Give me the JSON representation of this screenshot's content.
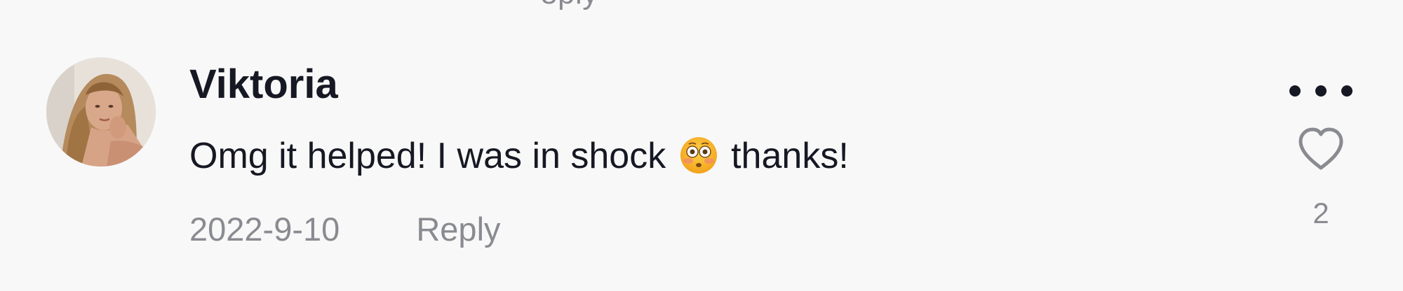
{
  "previous_comment": {
    "reply_label_fragment": "eply"
  },
  "comment": {
    "username": "Viktoria",
    "text_before_emoji": "Omg it helped! I was in shock",
    "emoji": "flushed-face-emoji",
    "text_after_emoji": "thanks!",
    "date": "2022-9-10",
    "reply_label": "Reply",
    "like_count": "2",
    "icons": {
      "more": "more-horizontal-icon",
      "like": "heart-outline-icon"
    }
  },
  "colors": {
    "background": "#f8f8f8",
    "primary_text": "#161823",
    "secondary_text": "#8a8b91",
    "icon_gray": "#8a8b91"
  }
}
